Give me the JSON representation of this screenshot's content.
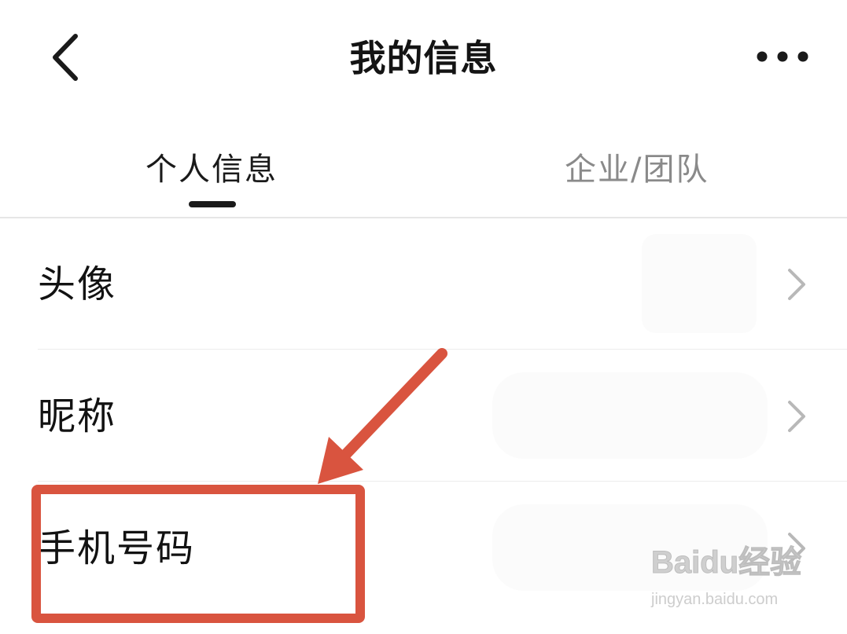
{
  "header": {
    "back_icon": "chevron-left-icon",
    "title": "我的信息",
    "more_icon": "more-horizontal-icon"
  },
  "tabs": [
    {
      "label": "个人信息",
      "active": true
    },
    {
      "label": "企业/团队",
      "active": false
    }
  ],
  "rows": [
    {
      "label": "头像",
      "icon": "chevron-right-icon"
    },
    {
      "label": "昵称",
      "icon": "chevron-right-icon"
    },
    {
      "label": "手机号码",
      "icon": "chevron-right-icon"
    }
  ],
  "annotation": {
    "color": "#d9543f"
  },
  "watermark": {
    "brand": "Baidu经验",
    "url": "jingyan.baidu.com"
  }
}
